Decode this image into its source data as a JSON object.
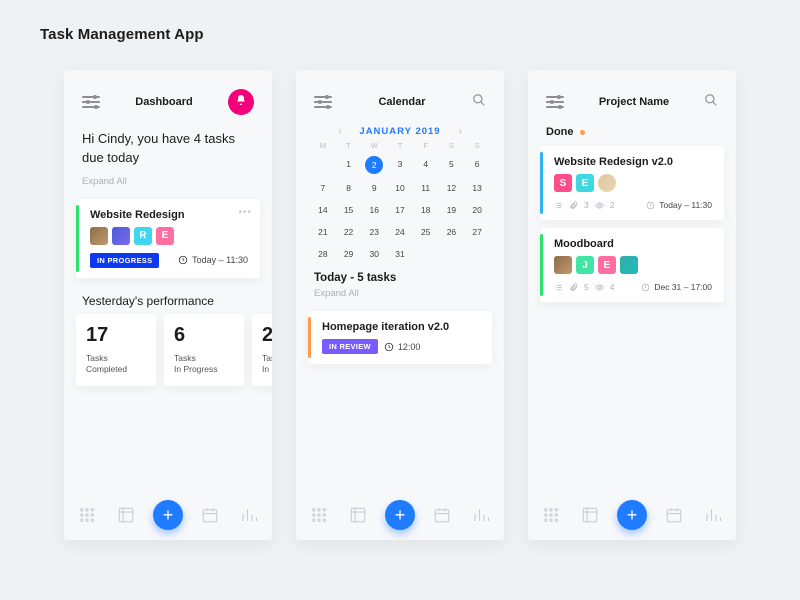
{
  "page_title": "Task Management App",
  "dashboard": {
    "title": "Dashboard",
    "greeting": "Hi Cindy, you have 4 tasks due today",
    "expand_all": "Expand All",
    "task": {
      "title": "Website Redesign",
      "avatars": [
        "picA",
        "picB",
        "R",
        "E"
      ],
      "status": "IN PROGRESS",
      "due": "Today – 11:30"
    },
    "perf_title": "Yesterday's performance",
    "stats": [
      {
        "n": "17",
        "l1": "Tasks",
        "l2": "Completed"
      },
      {
        "n": "6",
        "l1": "Tasks",
        "l2": "In Progress"
      },
      {
        "n": "2",
        "l1": "Tasks",
        "l2": "In Rev"
      }
    ]
  },
  "calendar": {
    "title": "Calendar",
    "month": "JANUARY 2019",
    "dow": [
      "M",
      "T",
      "W",
      "T",
      "F",
      "S",
      "S"
    ],
    "days": [
      [
        "",
        "1",
        "2",
        "3",
        "4",
        "5",
        "6"
      ],
      [
        "7",
        "8",
        "9",
        "10",
        "11",
        "12",
        "13"
      ],
      [
        "14",
        "15",
        "16",
        "17",
        "18",
        "19",
        "20"
      ],
      [
        "21",
        "22",
        "23",
        "24",
        "25",
        "26",
        "27"
      ],
      [
        "28",
        "29",
        "30",
        "31",
        "",
        "",
        ""
      ]
    ],
    "selected": "2",
    "today_label": "Today - 5 tasks",
    "expand_all": "Expand All",
    "task": {
      "title": "Homepage iteration v2.0",
      "status": "IN REVIEW",
      "time": "12:00"
    }
  },
  "project": {
    "title": "Project Name",
    "done_label": "Done",
    "tasks": [
      {
        "title": "Website Redesign v2.0",
        "avatars": [
          "S",
          "E2",
          "picC"
        ],
        "stripe": "blue",
        "attachments": "3",
        "views": "2",
        "due": "Today – 11:30"
      },
      {
        "title": "Moodboard",
        "avatars": [
          "picA",
          "J",
          "E",
          "picD"
        ],
        "stripe": "green",
        "attachments": "5",
        "views": "4",
        "due": "Dec 31 – 17:00"
      }
    ]
  }
}
